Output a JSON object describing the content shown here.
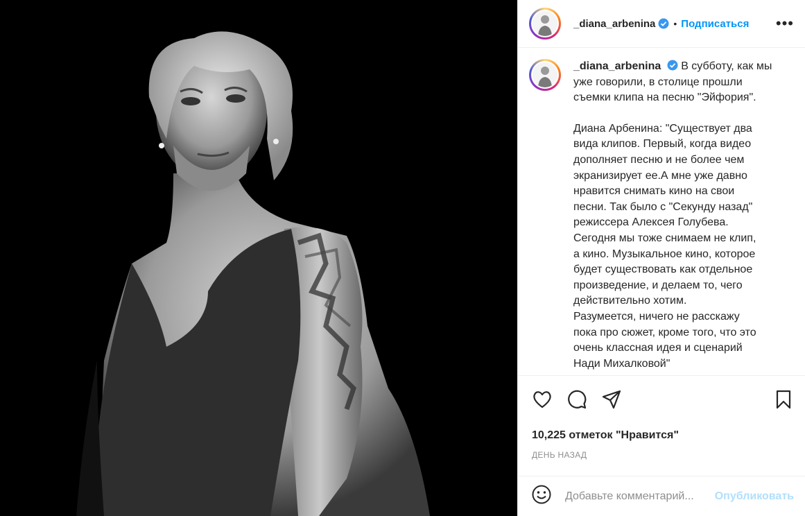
{
  "post": {
    "username": "_diana_arbenina",
    "dot": "•",
    "follow_label": "Подписаться",
    "more_label": "•••",
    "caption_lines": [
      "В субботу, как мы",
      "уже говорили, в столице прошли",
      "съемки клипа на песню \"Эйфория\"."
    ],
    "caption_lines2": [
      "Диана Арбенина: \"Существует два",
      "вида клипов. Первый, когда видео",
      "дополняет песню и не более чем",
      "экранизирует ее.А мне уже давно",
      "нравится снимать кино на свои",
      "песни. Так было с \"Секунду назад\"",
      "режиссера Алексея Голубева.",
      "Сегодня мы тоже снимаем не клип,",
      "а кино. Музыкальное кино, которое",
      "будет существовать как отдельное",
      "произведение, и делаем то, чего",
      "действительно хотим.",
      "Разумеется, ничего не расскажу",
      "пока про сюжет, кроме того, что это",
      "очень классная идея и сценарий",
      "Нади Михалковой\""
    ],
    "likes": "10,225 отметок \"Нравится\"",
    "time": "ДЕНЬ НАЗАД",
    "comment_placeholder": "Добавьте комментарий...",
    "publish_label": "Опубликовать"
  },
  "icons": {
    "like": "heart-icon",
    "comment": "comment-icon",
    "share": "send-icon",
    "save": "bookmark-icon",
    "emoji": "emoji-icon",
    "verified": "verified-badge-icon"
  },
  "colors": {
    "accent": "#0095f6",
    "publish_disabled": "#b2dffc",
    "verified": "#3897f0",
    "muted": "#8e8e8e"
  }
}
